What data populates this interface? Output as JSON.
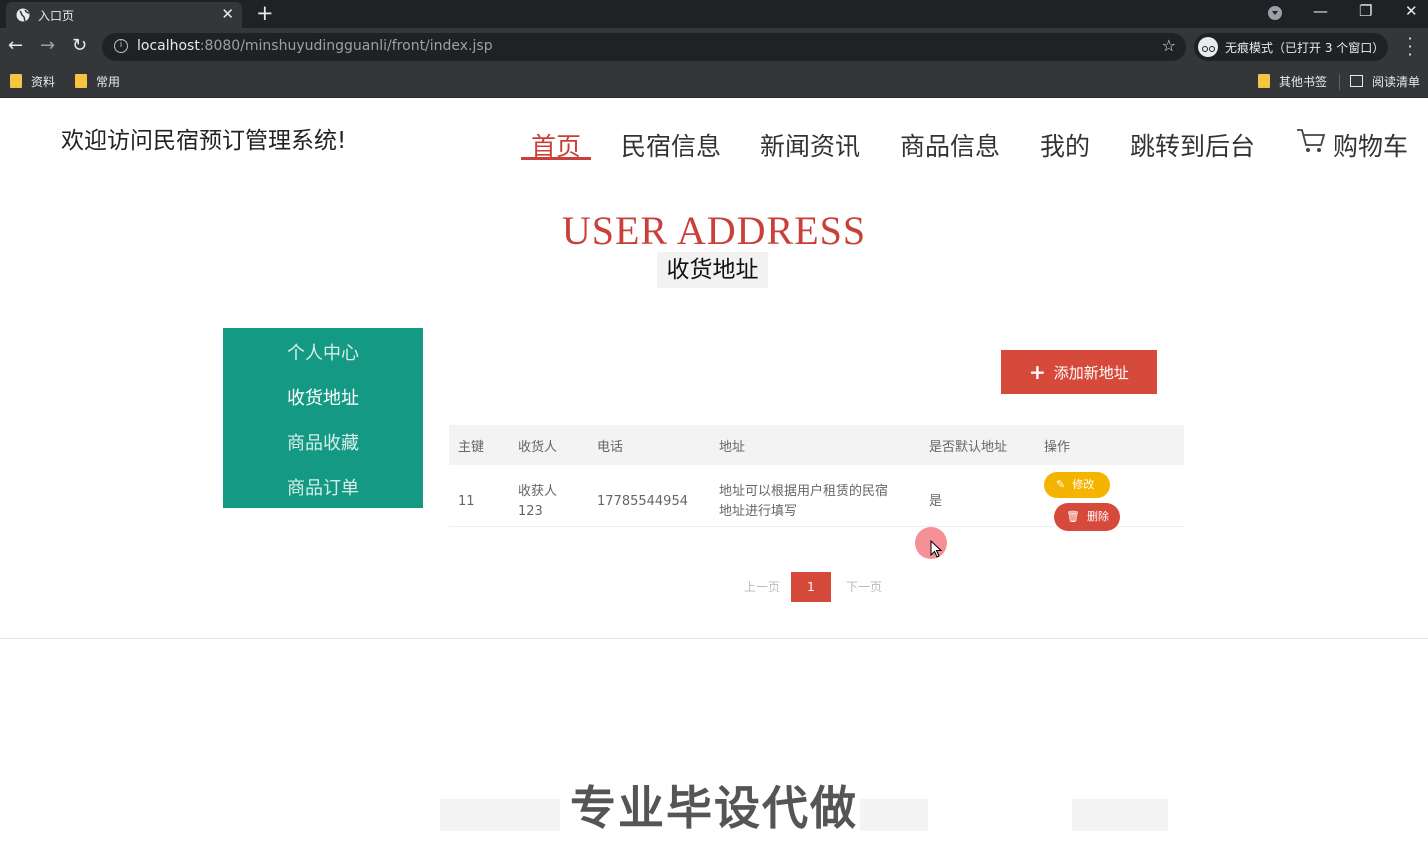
{
  "browser": {
    "tab_title": "入口页",
    "tab_close": "✕",
    "new_tab": "+",
    "url_host": "localhost",
    "url_rest": ":8080/minshuyudingguanli/front/index.jsp",
    "incognito_text": "无痕模式（已打开 3 个窗口）",
    "bookmarks": [
      "资料",
      "常用"
    ],
    "other_bookmarks": "其他书签",
    "reading_list": "阅读清单"
  },
  "header": {
    "welcome": "欢迎访问民宿预订管理系统!",
    "nav": [
      "首页",
      "民宿信息",
      "新闻资讯",
      "商品信息",
      "我的",
      "跳转到后台",
      "购物车"
    ]
  },
  "section": {
    "title_en": "USER ADDRESS",
    "title_cn": "收货地址"
  },
  "sidebar": {
    "items": [
      "个人中心",
      "收货地址",
      "商品收藏",
      "商品订单"
    ],
    "active_index": 1
  },
  "actions": {
    "add_address": "添加新地址"
  },
  "table": {
    "headers": [
      "主键",
      "收货人",
      "电话",
      "地址",
      "是否默认地址",
      "操作"
    ],
    "rows": [
      {
        "id": "11",
        "name": "收获人123",
        "phone": "17785544954",
        "address": "地址可以根据用户租赁的民宿地址进行填写",
        "is_default": "是",
        "edit": "修改",
        "delete": "删除"
      }
    ]
  },
  "pagination": {
    "prev": "上一页",
    "current": "1",
    "next": "下一页"
  },
  "watermark": "专业毕设代做",
  "colors": {
    "accent_red": "#c9403a",
    "sidebar_green": "#149a84",
    "edit_yellow": "#f5b400",
    "delete_red": "#d64a3b"
  }
}
